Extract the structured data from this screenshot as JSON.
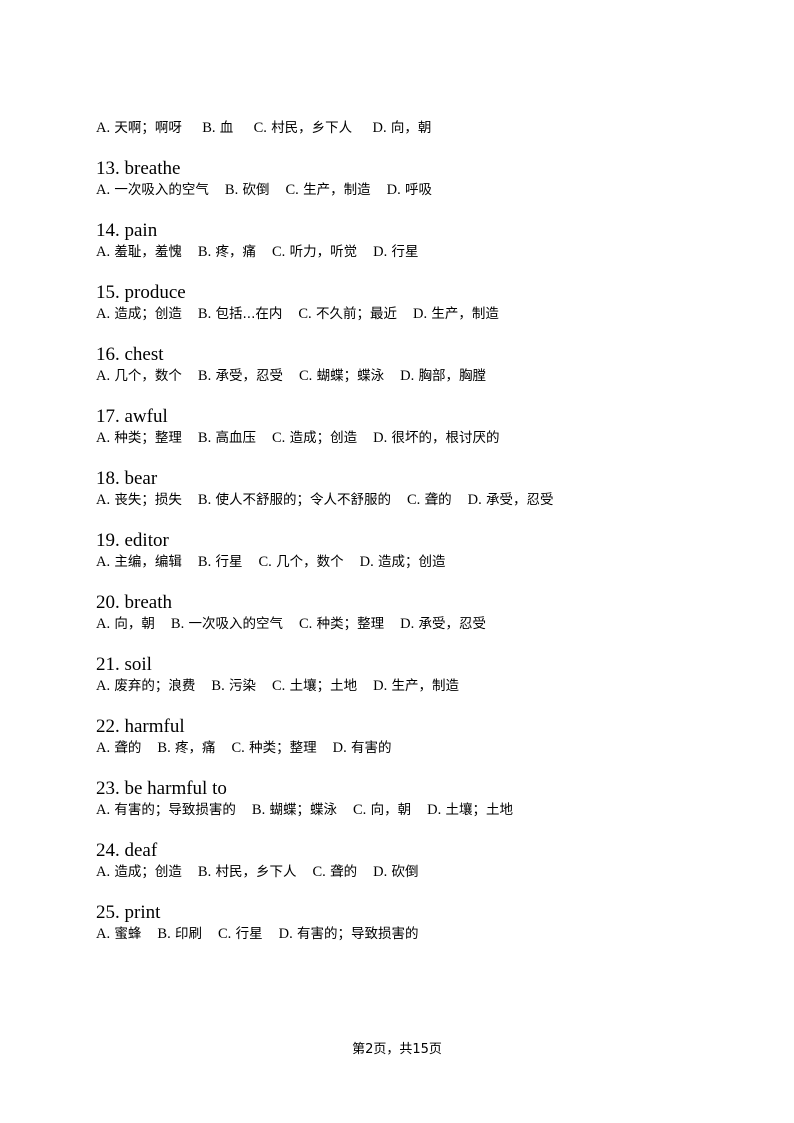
{
  "first_options": [
    {
      "letter": "A.",
      "text": "天啊；啊呀"
    },
    {
      "letter": "B.",
      "text": "血"
    },
    {
      "letter": "C.",
      "text": "村民，乡下人"
    },
    {
      "letter": "D.",
      "text": "向，朝"
    }
  ],
  "questions": [
    {
      "number": "13.",
      "word": "breathe",
      "options": [
        {
          "letter": "A.",
          "text": "一次吸入的空气"
        },
        {
          "letter": "B.",
          "text": "砍倒"
        },
        {
          "letter": "C.",
          "text": "生产，制造"
        },
        {
          "letter": "D.",
          "text": "呼吸"
        }
      ]
    },
    {
      "number": "14.",
      "word": "pain",
      "options": [
        {
          "letter": "A.",
          "text": "羞耻，羞愧"
        },
        {
          "letter": "B.",
          "text": "疼，痛"
        },
        {
          "letter": "C.",
          "text": "听力，听觉"
        },
        {
          "letter": "D.",
          "text": "行星"
        }
      ]
    },
    {
      "number": "15.",
      "word": "produce",
      "options": [
        {
          "letter": "A.",
          "text": "造成；创造"
        },
        {
          "letter": "B.",
          "text": "包括...在内"
        },
        {
          "letter": "C.",
          "text": "不久前；最近"
        },
        {
          "letter": "D.",
          "text": "生产，制造"
        }
      ]
    },
    {
      "number": "16.",
      "word": "chest",
      "options": [
        {
          "letter": "A.",
          "text": "几个，数个"
        },
        {
          "letter": "B.",
          "text": "承受，忍受"
        },
        {
          "letter": "C.",
          "text": "蝴蝶；蝶泳"
        },
        {
          "letter": "D.",
          "text": "胸部，胸膛"
        }
      ]
    },
    {
      "number": "17.",
      "word": "awful",
      "options": [
        {
          "letter": "A.",
          "text": "种类；整理"
        },
        {
          "letter": "B.",
          "text": "高血压"
        },
        {
          "letter": "C.",
          "text": "造成；创造"
        },
        {
          "letter": "D.",
          "text": "很坏的，根讨厌的"
        }
      ]
    },
    {
      "number": "18.",
      "word": "bear",
      "options": [
        {
          "letter": "A.",
          "text": "丧失；损失"
        },
        {
          "letter": "B.",
          "text": "使人不舒服的；令人不舒服的"
        },
        {
          "letter": "C.",
          "text": "聋的"
        },
        {
          "letter": "D.",
          "text": "承受，忍受"
        }
      ]
    },
    {
      "number": "19.",
      "word": "editor",
      "options": [
        {
          "letter": "A.",
          "text": "主编，编辑"
        },
        {
          "letter": "B.",
          "text": "行星"
        },
        {
          "letter": "C.",
          "text": "几个，数个"
        },
        {
          "letter": "D.",
          "text": "造成；创造"
        }
      ]
    },
    {
      "number": "20.",
      "word": "breath",
      "options": [
        {
          "letter": "A.",
          "text": "向，朝"
        },
        {
          "letter": "B.",
          "text": "一次吸入的空气"
        },
        {
          "letter": "C.",
          "text": "种类；整理"
        },
        {
          "letter": "D.",
          "text": "承受，忍受"
        }
      ]
    },
    {
      "number": "21.",
      "word": "soil",
      "options": [
        {
          "letter": "A.",
          "text": "废弃的；浪费"
        },
        {
          "letter": "B.",
          "text": "污染"
        },
        {
          "letter": "C.",
          "text": "土壤；土地"
        },
        {
          "letter": "D.",
          "text": "生产，制造"
        }
      ]
    },
    {
      "number": "22.",
      "word": "harmful",
      "options": [
        {
          "letter": "A.",
          "text": "聋的"
        },
        {
          "letter": "B.",
          "text": "疼，痛"
        },
        {
          "letter": "C.",
          "text": "种类；整理"
        },
        {
          "letter": "D.",
          "text": "有害的"
        }
      ]
    },
    {
      "number": "23.",
      "word": "be harmful to",
      "options": [
        {
          "letter": "A.",
          "text": "有害的；导致损害的"
        },
        {
          "letter": "B.",
          "text": "蝴蝶；蝶泳"
        },
        {
          "letter": "C.",
          "text": "向，朝"
        },
        {
          "letter": "D.",
          "text": "土壤；土地"
        }
      ]
    },
    {
      "number": "24.",
      "word": "deaf",
      "options": [
        {
          "letter": "A.",
          "text": "造成；创造"
        },
        {
          "letter": "B.",
          "text": "村民，乡下人"
        },
        {
          "letter": "C.",
          "text": "聋的"
        },
        {
          "letter": "D.",
          "text": "砍倒"
        }
      ]
    },
    {
      "number": "25.",
      "word": "print",
      "options": [
        {
          "letter": "A.",
          "text": "蜜蜂"
        },
        {
          "letter": "B.",
          "text": "印刷"
        },
        {
          "letter": "C.",
          "text": "行星"
        },
        {
          "letter": "D.",
          "text": "有害的；导致损害的"
        }
      ]
    }
  ],
  "footer": {
    "page_label": "第2页，共15页"
  }
}
